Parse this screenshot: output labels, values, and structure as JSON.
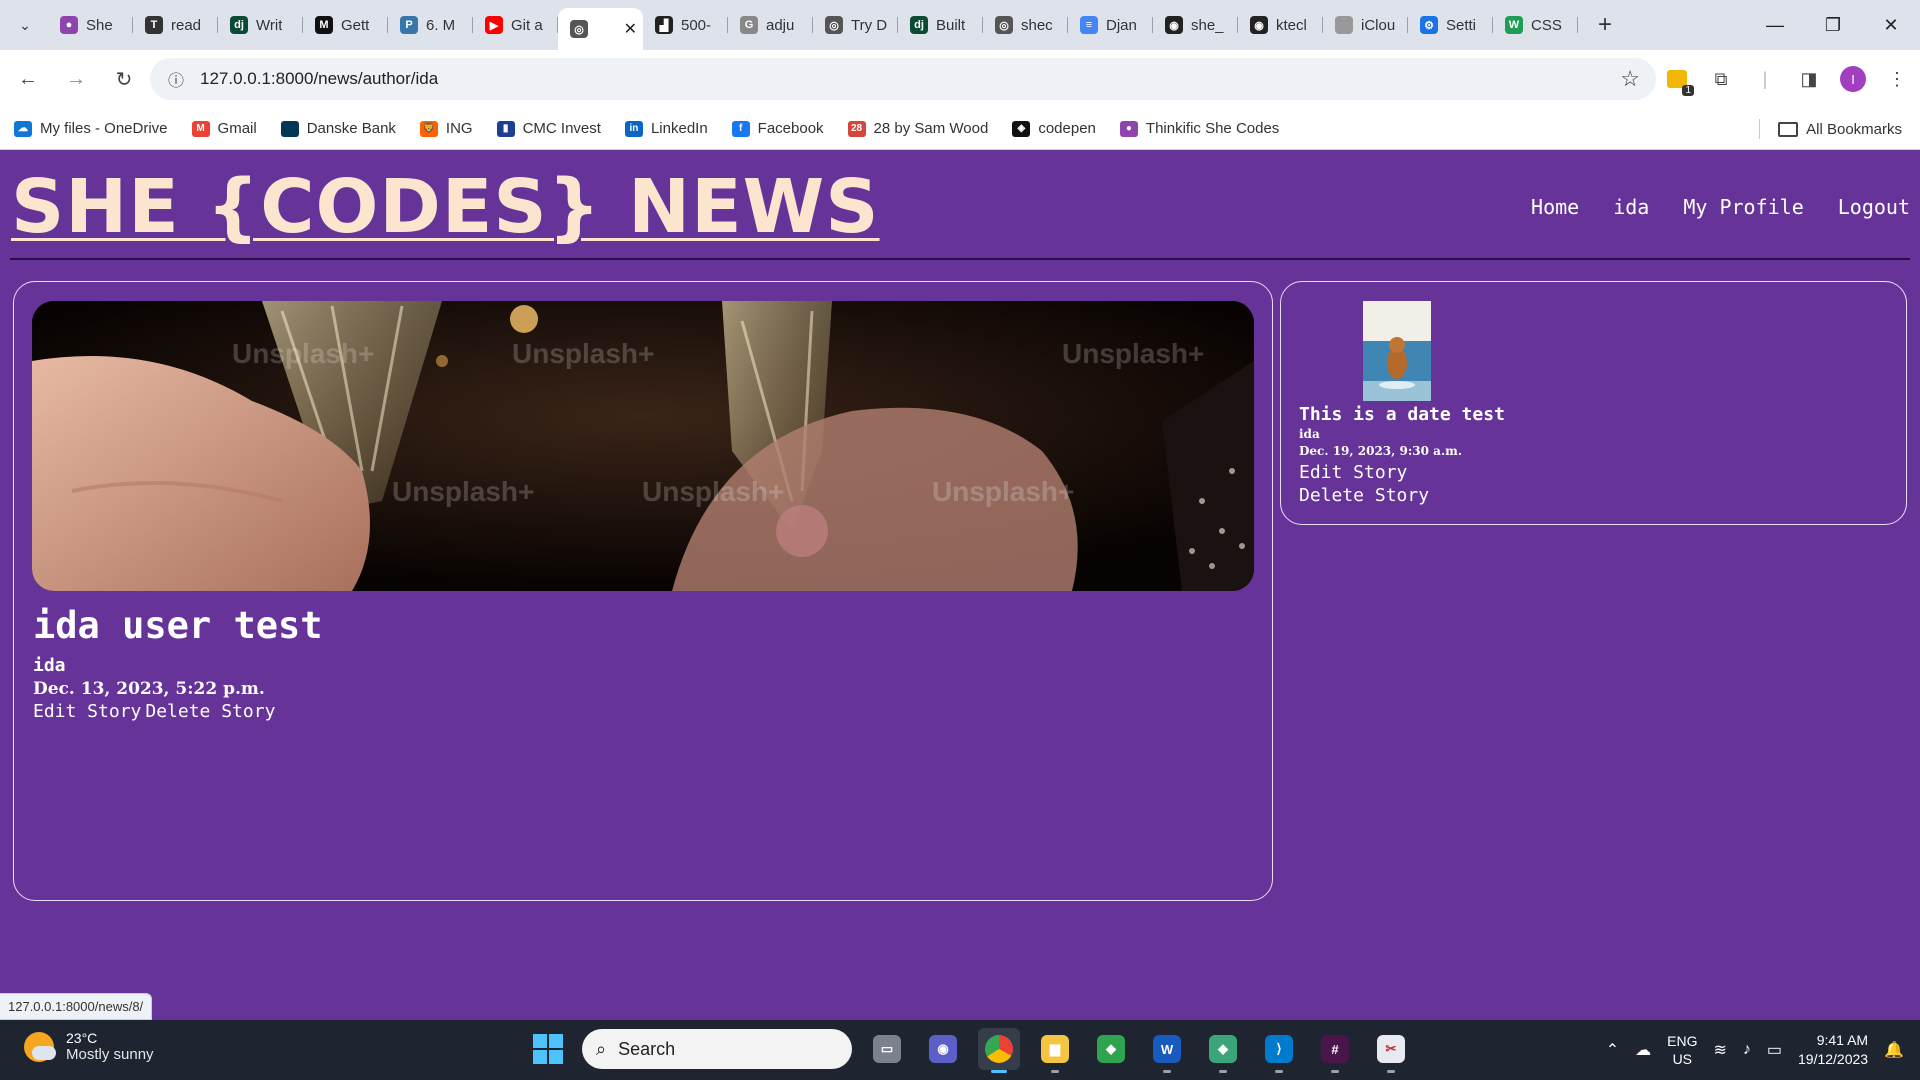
{
  "browser": {
    "tabs": [
      {
        "title": "She",
        "color": "#8e44ad",
        "glyph": "●"
      },
      {
        "title": "read",
        "color": "#333333",
        "glyph": "T"
      },
      {
        "title": "Writ",
        "color": "#0c4b33",
        "glyph": "dj"
      },
      {
        "title": "Gett",
        "color": "#111111",
        "glyph": "M"
      },
      {
        "title": "6. M",
        "color": "#3776ab",
        "glyph": "P"
      },
      {
        "title": "Git a",
        "color": "#ff0000",
        "glyph": "▶"
      },
      {
        "title": "",
        "color": "#555555",
        "glyph": "◎",
        "active": true
      },
      {
        "title": "500-",
        "color": "#222222",
        "glyph": "▟"
      },
      {
        "title": "adju",
        "color": "#888888",
        "glyph": "G"
      },
      {
        "title": "Try D",
        "color": "#555555",
        "glyph": "◎"
      },
      {
        "title": "Built",
        "color": "#0c4b33",
        "glyph": "dj"
      },
      {
        "title": "shec",
        "color": "#555555",
        "glyph": "◎"
      },
      {
        "title": "Djan",
        "color": "#4285f4",
        "glyph": "≡"
      },
      {
        "title": "she_",
        "color": "#222222",
        "glyph": "◉"
      },
      {
        "title": "ktecl",
        "color": "#222222",
        "glyph": "◉"
      },
      {
        "title": "iClou",
        "color": "#999999",
        "glyph": ""
      },
      {
        "title": "Setti",
        "color": "#1a73e8",
        "glyph": "⚙"
      },
      {
        "title": "CSS",
        "color": "#1f9d55",
        "glyph": "W"
      }
    ],
    "url": "127.0.0.1:8000/news/author/ida",
    "extension_badge": "1",
    "profile_initial": "I",
    "bookmarks": [
      {
        "label": "My files - OneDrive",
        "color": "#0f78d4",
        "glyph": "☁"
      },
      {
        "label": "Gmail",
        "color": "#ea4335",
        "glyph": "M"
      },
      {
        "label": "Danske Bank",
        "color": "#003755",
        "glyph": ""
      },
      {
        "label": "ING",
        "color": "#ff6200",
        "glyph": "🦁"
      },
      {
        "label": "CMC Invest",
        "color": "#1c3f94",
        "glyph": "▮"
      },
      {
        "label": "LinkedIn",
        "color": "#0a66c2",
        "glyph": "in"
      },
      {
        "label": "Facebook",
        "color": "#1877f2",
        "glyph": "f"
      },
      {
        "label": "28 by Sam Wood",
        "color": "#d6453d",
        "glyph": "28"
      },
      {
        "label": "codepen",
        "color": "#111111",
        "glyph": "◈"
      },
      {
        "label": "Thinkific She Codes",
        "color": "#8e44ad",
        "glyph": "●"
      }
    ],
    "all_bookmarks": "All Bookmarks",
    "status_url": "127.0.0.1:8000/news/8/"
  },
  "site": {
    "logo": "SHE {CODES} NEWS",
    "nav": [
      "Home",
      "ida",
      "My Profile",
      "Logout"
    ],
    "main_story": {
      "title": "ida user test",
      "author": "ida",
      "date": "Dec. 13, 2023, 5:22 p.m.",
      "edit": "Edit Story",
      "delete": "Delete Story",
      "watermark": "Unsplash+"
    },
    "side_story": {
      "title": "This is a date test",
      "author": "ida",
      "date": "Dec. 19, 2023, 9:30 a.m.",
      "edit": "Edit Story",
      "delete": "Delete Story"
    }
  },
  "taskbar": {
    "temperature": "23°C",
    "weather": "Mostly sunny",
    "search_placeholder": "Search",
    "lang_top": "ENG",
    "lang_bottom": "US",
    "time": "9:41 AM",
    "date": "19/12/2023"
  },
  "colors": {
    "page_bg": "#663399",
    "logo": "#fbe5cf",
    "accent_blue": "#4cc2ff"
  }
}
